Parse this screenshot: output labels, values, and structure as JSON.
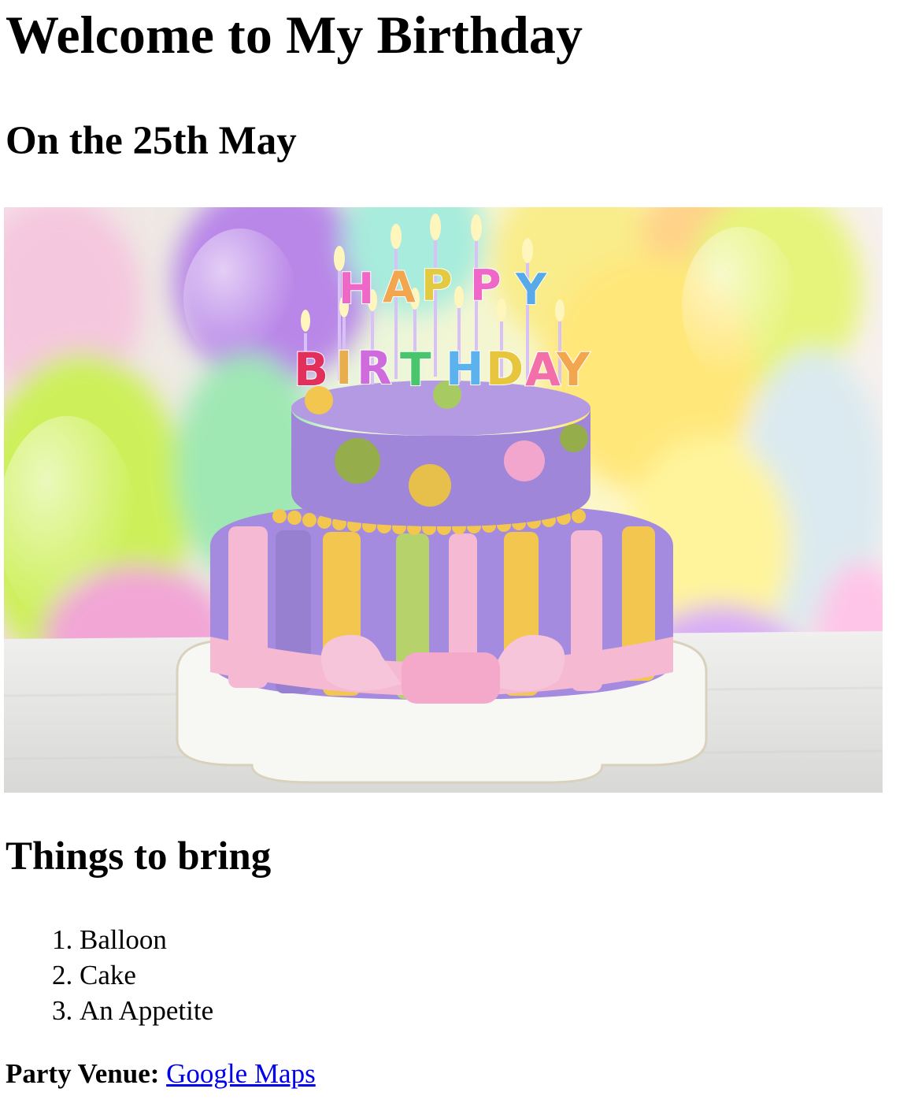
{
  "page": {
    "title": "Welcome to My Birthday",
    "subtitle": "On the 25th May"
  },
  "hero_image": {
    "alt": "Birthday cake",
    "candles_top": [
      "H",
      "A",
      "P",
      "P",
      "Y"
    ],
    "candles_bottom": [
      "B",
      "I",
      "R",
      "T",
      "H",
      "D",
      "A",
      "Y"
    ],
    "colors": {
      "cake_top": "#9f86d9",
      "cake_bottom": "#a58be0",
      "stripe_pink": "#f5b9d4",
      "stripe_yellow": "#f2c64f",
      "stripe_green": "#b6d26b",
      "ribbon": "#f6b9d2",
      "plate": "#f7f7f4"
    }
  },
  "things_to_bring": {
    "heading": "Things to bring",
    "items": [
      "Balloon",
      "Cake",
      "An Appetite"
    ]
  },
  "venue": {
    "label": "Party Venue:",
    "link_text": "Google Maps"
  }
}
